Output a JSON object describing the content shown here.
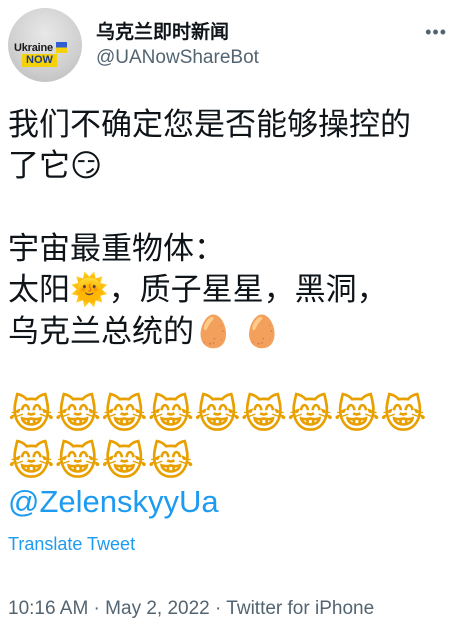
{
  "author": {
    "name": "乌克兰即时新闻",
    "handle": "@UANowShareBot",
    "avatar_text_top": "Ukraine",
    "avatar_text_bottom": "NOW"
  },
  "more_icon": "more-dots-icon",
  "tweet": {
    "line1": "我们不确定您是否能够操控的",
    "line2": "了它",
    "line2_emoji": "😏",
    "line3": "宇宙最重物体：",
    "line4a": "太阳",
    "line4_emoji": "🌞",
    "line4b": "，质子星星，黑洞，",
    "line5": "乌克兰总统的",
    "line5_emoji": "🥚 🥚",
    "emoji_row1": [
      "😹",
      "😹",
      "😹",
      "😹",
      "😹",
      "😹",
      "😹",
      "😹",
      "😹"
    ],
    "emoji_row2": [
      "😹",
      "😹",
      "😹",
      "😹"
    ],
    "mention": "@ZelenskyyUa"
  },
  "translate_label": "Translate Tweet",
  "meta": {
    "time": "10:16 AM",
    "date": "May 2, 2022",
    "source": "Twitter for iPhone",
    "separator": " · "
  },
  "colors": {
    "link": "#1d9bf0",
    "secondary_text": "#536471",
    "primary_text": "#0f1419"
  }
}
